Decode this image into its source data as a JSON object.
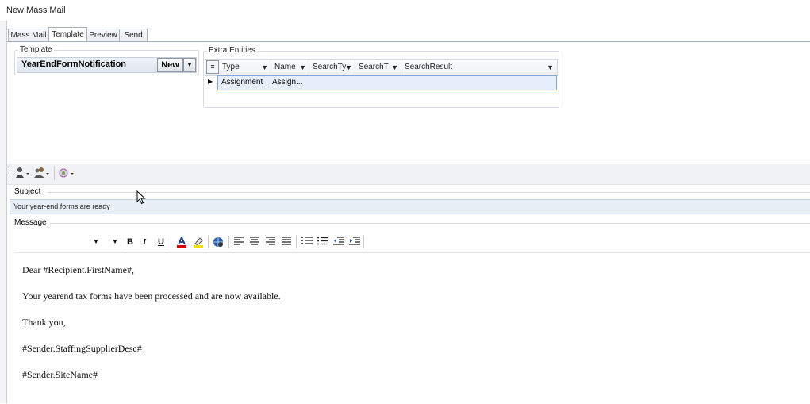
{
  "window": {
    "title": "New Mass Mail"
  },
  "tabs": [
    {
      "label": "Mass Mail",
      "active": false
    },
    {
      "label": "Template",
      "active": true
    },
    {
      "label": "Preview",
      "active": false
    },
    {
      "label": "Send",
      "active": false
    }
  ],
  "template": {
    "legend": "Template",
    "selected": "YearEndFormNotification",
    "new_label": "New",
    "dropdown_icon": "triangle-down-icon"
  },
  "extra_entities": {
    "legend": "Extra Entities",
    "columns": [
      "Type",
      "Name",
      "SearchTy",
      "SearchT",
      "SearchResult"
    ],
    "rows": [
      {
        "type": "Assignment",
        "name": "Assign..."
      }
    ]
  },
  "toolbar": {
    "icons": [
      "person-dropdown-icon",
      "group-dropdown-icon",
      "merge-field-dropdown-icon"
    ]
  },
  "subject": {
    "label": "Subject",
    "value": "Your year-end forms are ready"
  },
  "message": {
    "label": "Message",
    "toolbar": {
      "bold": "B",
      "italic": "I",
      "underline": "U",
      "font_color_icon": "font-color-icon",
      "highlight_icon": "highlight-icon",
      "link_icon": "hyperlink-icon"
    },
    "body": [
      "Dear #Recipient.FirstName#,",
      "Your yearend tax forms have been processed and are now available.",
      "Thank you,",
      "#Sender.StaffingSupplierDesc#",
      "#Sender.SiteName#"
    ]
  },
  "colors": {
    "accent": "#7fa9d9",
    "subject_bg": "#e8eef6",
    "font_color_bar": "#d40000",
    "highlight_bar": "#f0e000"
  }
}
